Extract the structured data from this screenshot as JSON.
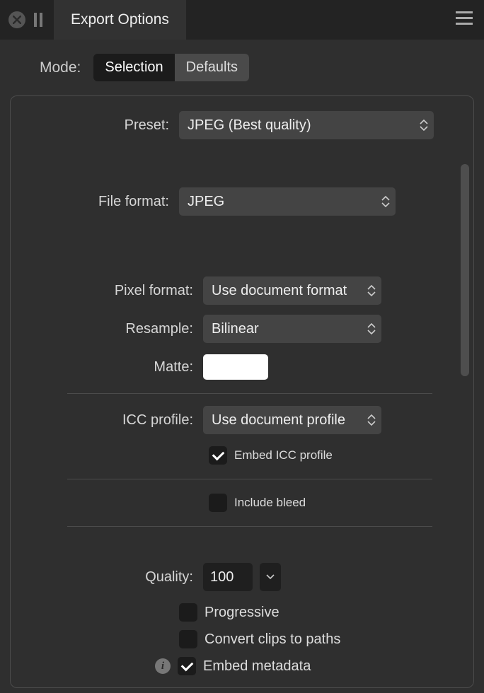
{
  "titlebar": {
    "tab_label": "Export Options"
  },
  "mode": {
    "label": "Mode:",
    "options": [
      "Selection",
      "Defaults"
    ],
    "selected": 0
  },
  "form": {
    "preset": {
      "label": "Preset:",
      "value": "JPEG (Best quality)"
    },
    "file_format": {
      "label": "File format:",
      "value": "JPEG"
    },
    "pixel_format": {
      "label": "Pixel format:",
      "value": "Use document format"
    },
    "resample": {
      "label": "Resample:",
      "value": "Bilinear"
    },
    "matte": {
      "label": "Matte:",
      "color": "#ffffff"
    },
    "icc_profile": {
      "label": "ICC profile:",
      "value": "Use document profile"
    },
    "embed_icc": {
      "label": "Embed ICC profile",
      "checked": true
    },
    "include_bleed": {
      "label": "Include bleed",
      "checked": false
    },
    "quality": {
      "label": "Quality:",
      "value": "100"
    },
    "progressive": {
      "label": "Progressive",
      "checked": false
    },
    "convert_clips": {
      "label": "Convert clips to paths",
      "checked": false
    },
    "embed_meta": {
      "label": "Embed metadata",
      "checked": true
    }
  }
}
